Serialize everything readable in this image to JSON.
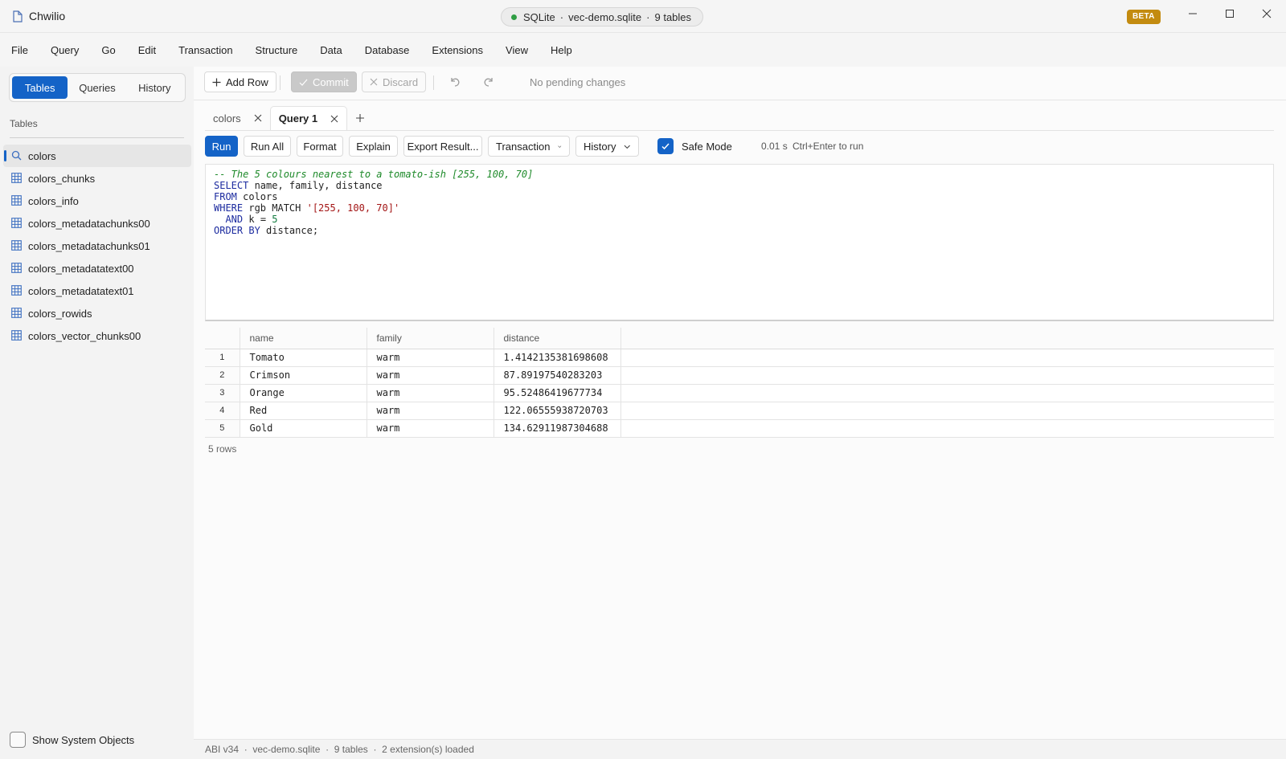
{
  "window": {
    "title": "Chwilio",
    "connection": {
      "engine": "SQLite",
      "file": "vec-demo.sqlite",
      "tables": "9 tables",
      "sep": "·",
      "status_color": "#2f9e44"
    },
    "badge": "BETA"
  },
  "menu": [
    "File",
    "Query",
    "Go",
    "Edit",
    "Transaction",
    "Structure",
    "Data",
    "Database",
    "Extensions",
    "View",
    "Help"
  ],
  "sidebar": {
    "tabs": [
      "Tables",
      "Queries",
      "History"
    ],
    "active_tab": "Tables",
    "section_label": "Tables",
    "items": [
      {
        "label": "colors",
        "icon": "search-icon"
      },
      {
        "label": "colors_chunks",
        "icon": "table-icon"
      },
      {
        "label": "colors_info",
        "icon": "table-icon"
      },
      {
        "label": "colors_metadatachunks00",
        "icon": "table-icon"
      },
      {
        "label": "colors_metadatachunks01",
        "icon": "table-icon"
      },
      {
        "label": "colors_metadatatext00",
        "icon": "table-icon"
      },
      {
        "label": "colors_metadatatext01",
        "icon": "table-icon"
      },
      {
        "label": "colors_rowids",
        "icon": "table-icon"
      },
      {
        "label": "colors_vector_chunks00",
        "icon": "table-icon"
      }
    ],
    "show_system_objects": "Show System Objects"
  },
  "toolbar": {
    "add_row": "Add Row",
    "commit": "Commit",
    "discard": "Discard",
    "status": "No pending changes"
  },
  "tabs": [
    {
      "label": "colors"
    },
    {
      "label": "Query 1"
    }
  ],
  "query_toolbar": {
    "run": "Run",
    "run_all": "Run All",
    "format": "Format",
    "explain": "Explain",
    "export": "Export Result...",
    "transaction": "Transaction",
    "history": "History",
    "safe_mode": "Safe Mode",
    "elapsed": "0.01 s",
    "hint": "Ctrl+Enter to run"
  },
  "editor": {
    "comment": "-- The 5 colours nearest to a tomato-ish [255, 100, 70]",
    "kw_select": "SELECT",
    "select_cols": " name, family, distance",
    "kw_from": "FROM",
    "from_table": " colors",
    "kw_where": "WHERE",
    "where_expr": " rgb MATCH ",
    "where_str": "'[255, 100, 70]'",
    "and_indent": "  ",
    "kw_and": "AND",
    "and_expr": " k = ",
    "and_num": "5",
    "kw_order": "ORDER BY",
    "order_expr": " distance;"
  },
  "results": {
    "columns": [
      "name",
      "family",
      "distance"
    ],
    "rows": [
      {
        "n": "1",
        "name": "Tomato",
        "family": "warm",
        "distance": "1.4142135381698608"
      },
      {
        "n": "2",
        "name": "Crimson",
        "family": "warm",
        "distance": "87.89197540283203"
      },
      {
        "n": "3",
        "name": "Orange",
        "family": "warm",
        "distance": "95.52486419677734"
      },
      {
        "n": "4",
        "name": "Red",
        "family": "warm",
        "distance": "122.06555938720703"
      },
      {
        "n": "5",
        "name": "Gold",
        "family": "warm",
        "distance": "134.62911987304688"
      }
    ],
    "row_count": "5 rows"
  },
  "statusbar": {
    "abi": "ABI v34",
    "file": "vec-demo.sqlite",
    "tables": "9 tables",
    "extensions": "2 extension(s) loaded",
    "sep": "  ·  "
  },
  "colors": {
    "accent": "#1463c7",
    "badge": "#c38b10"
  }
}
